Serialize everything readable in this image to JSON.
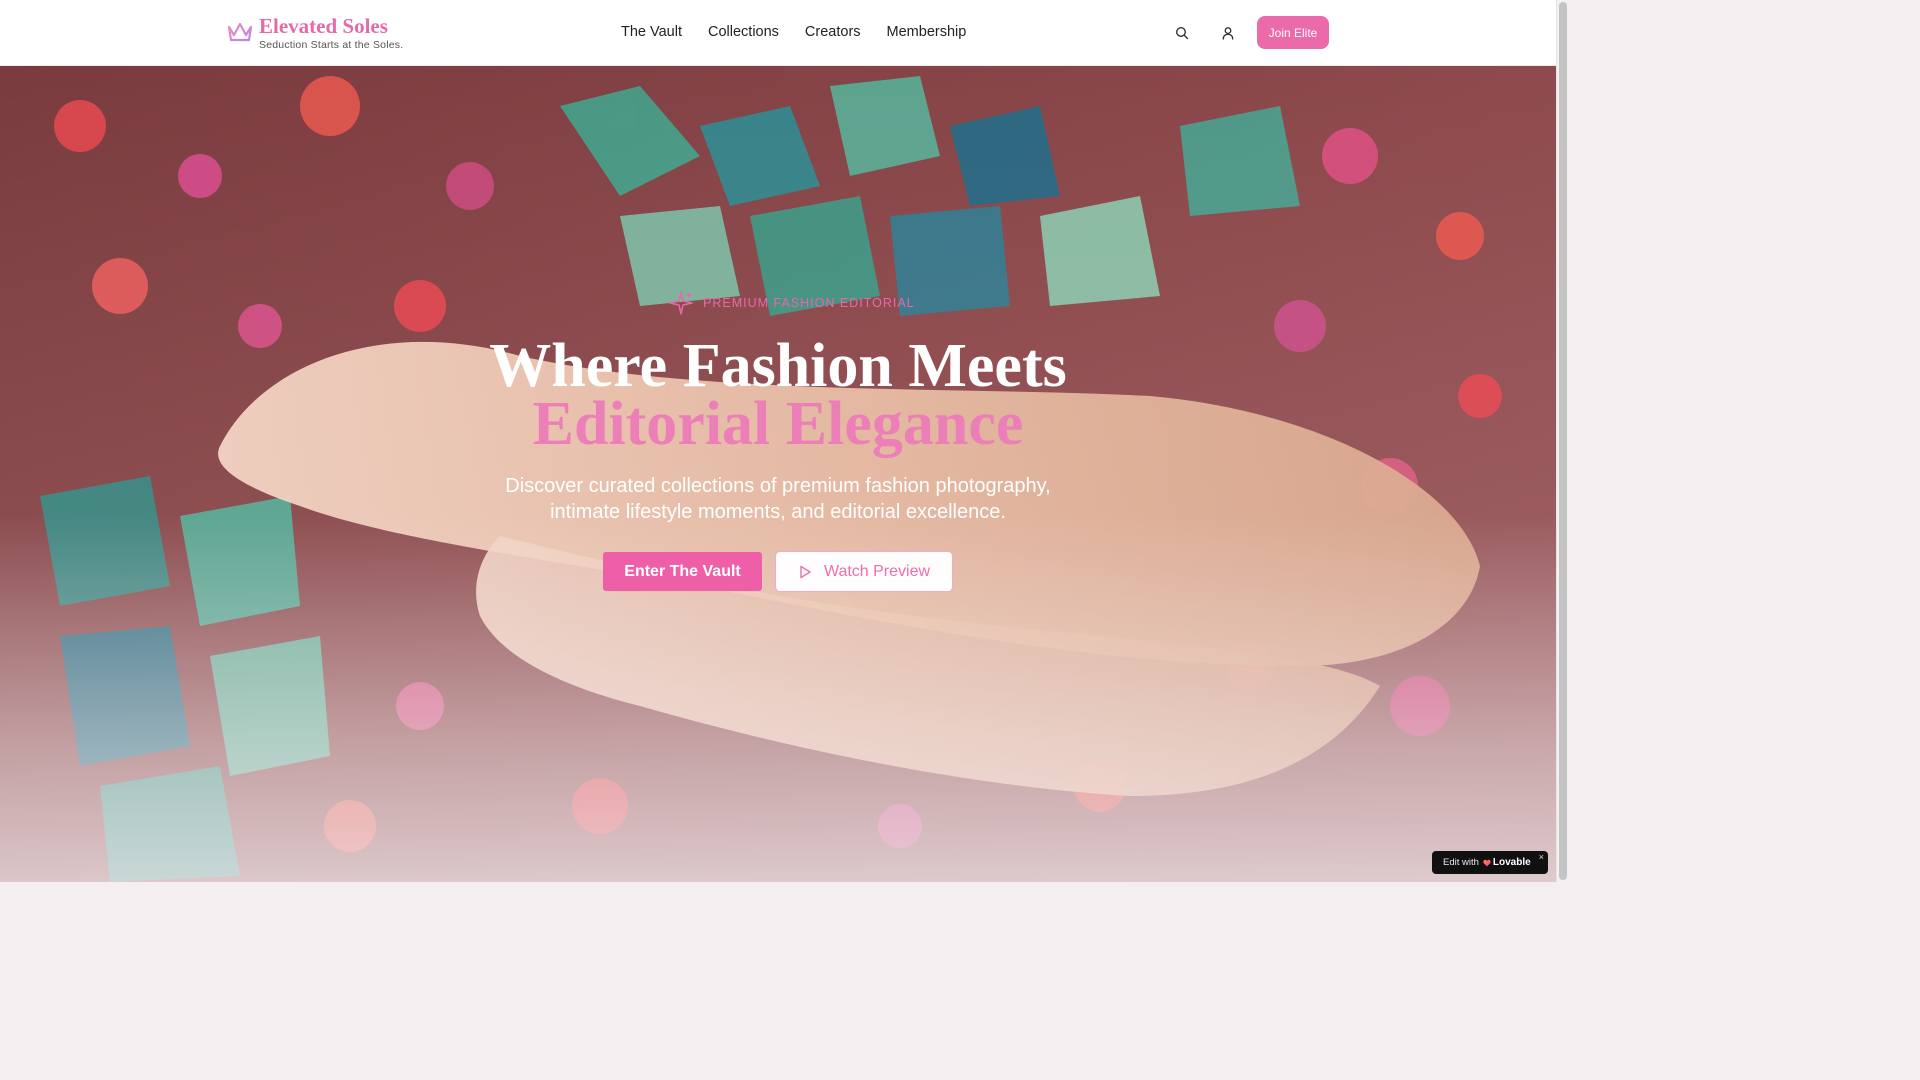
{
  "header": {
    "brand_title": "Elevated Soles",
    "brand_tagline": "Seduction Starts at the Soles.",
    "nav": [
      "The Vault",
      "Collections",
      "Creators",
      "Membership"
    ],
    "join_label": "Join Elite",
    "icons": [
      "crown-icon",
      "search-icon",
      "user-icon"
    ]
  },
  "hero": {
    "badge": "PREMIUM FASHION EDITORIAL",
    "headline_line1": "Where Fashion Meets",
    "headline_line2": "Editorial Elegance",
    "subtitle_line1": "Discover curated collections of premium fashion photography,",
    "subtitle_line2": "intimate lifestyle moments, and editorial excellence.",
    "primary_cta": "Enter The Vault",
    "secondary_cta": "Watch Preview"
  },
  "lovable": {
    "edit": "Edit with",
    "brand": "Lovable",
    "close": "×"
  },
  "colors": {
    "accent": "#e56aa9",
    "cta": "#ee5fa8",
    "headline_pink": "#ec7fb7"
  }
}
